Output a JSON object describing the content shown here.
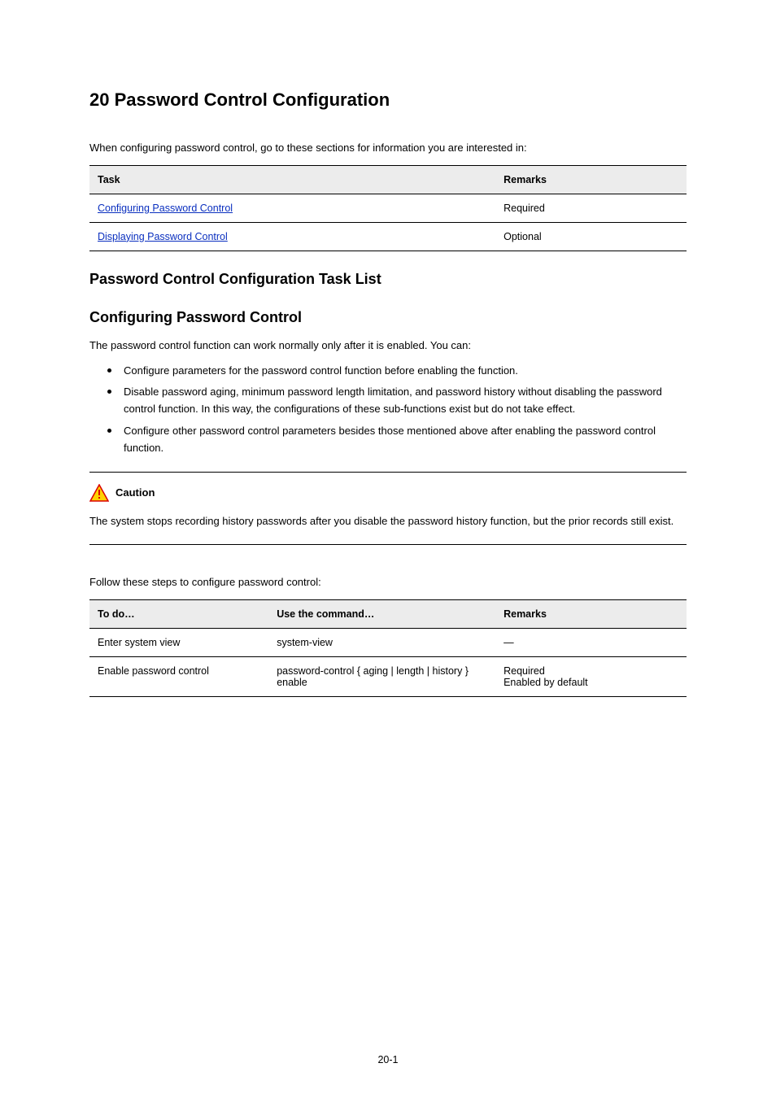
{
  "headings": {
    "h1": "20  Password Control Configuration",
    "h2_intro": "Password Control Configuration Task List",
    "h2_config": "Configuring Password Control"
  },
  "intro_para": "When configuring password control, go to these sections for information you are interested in:",
  "task_table": {
    "caption": "",
    "headers": [
      "Task",
      "Remarks"
    ],
    "rows": [
      {
        "prefix": "",
        "task": "Configuring Password Control",
        "remark": "Required"
      },
      {
        "prefix": "",
        "task": "Displaying Password Control",
        "remark": "Optional"
      }
    ]
  },
  "config_intro": "The password control function can work normally only after it is enabled. You can:",
  "bullets": [
    "Configure parameters for the password control function before enabling the function.",
    "Disable password aging, minimum password length limitation, and password history without disabling the password control function. In this way, the configurations of these sub-functions exist but do not take effect.",
    "Configure other password control parameters besides those mentioned above after enabling the password control function."
  ],
  "caution": {
    "label": "Caution",
    "text": "The system stops recording history passwords after you disable the password history function, but the prior records still exist."
  },
  "steps_para": "Follow these steps to configure password control:",
  "steps_table": {
    "headers": [
      "To do…",
      "Use the command…",
      "Remarks"
    ],
    "rows": [
      {
        "todo": "Enter system view",
        "cmd": "system-view",
        "remark": "—"
      },
      {
        "todo": "Enable password control",
        "cmd": "password-control { aging | length | history } enable",
        "remark": "Required\nEnabled by default"
      }
    ]
  },
  "page_number": "20-1"
}
